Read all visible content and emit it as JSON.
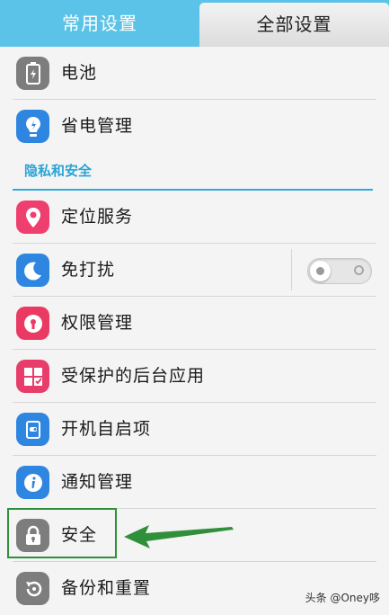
{
  "tabs": {
    "common": "常用设置",
    "all": "全部设置"
  },
  "rows_top": [
    {
      "label": "电池",
      "icon": "battery-icon",
      "color": "#7d7d7d"
    },
    {
      "label": "省电管理",
      "icon": "lightbulb-icon",
      "color": "#2f86e0"
    }
  ],
  "section": {
    "title": "隐私和安全"
  },
  "rows_privacy": [
    {
      "label": "定位服务",
      "icon": "location-pin-icon",
      "color": "#ef3f6e"
    },
    {
      "label": "免打扰",
      "icon": "moon-icon",
      "color": "#2f86e0"
    },
    {
      "label": "权限管理",
      "icon": "keyhole-icon",
      "color": "#ea3a63"
    },
    {
      "label": "受保护的后台应用",
      "icon": "grid-shield-icon",
      "color": "#e83c6a"
    },
    {
      "label": "开机自启项",
      "icon": "power-switch-icon",
      "color": "#2f86e0"
    },
    {
      "label": "通知管理",
      "icon": "info-icon",
      "color": "#2f86e0"
    },
    {
      "label": "安全",
      "icon": "padlock-icon",
      "color": "#7d7d7d"
    },
    {
      "label": "备份和重置",
      "icon": "restore-icon",
      "color": "#7d7d7d"
    }
  ],
  "toggle": {
    "dnd_enabled": false
  },
  "annotation": {
    "color": "#2f8f3a"
  },
  "watermark": "头条 @Oney哆"
}
